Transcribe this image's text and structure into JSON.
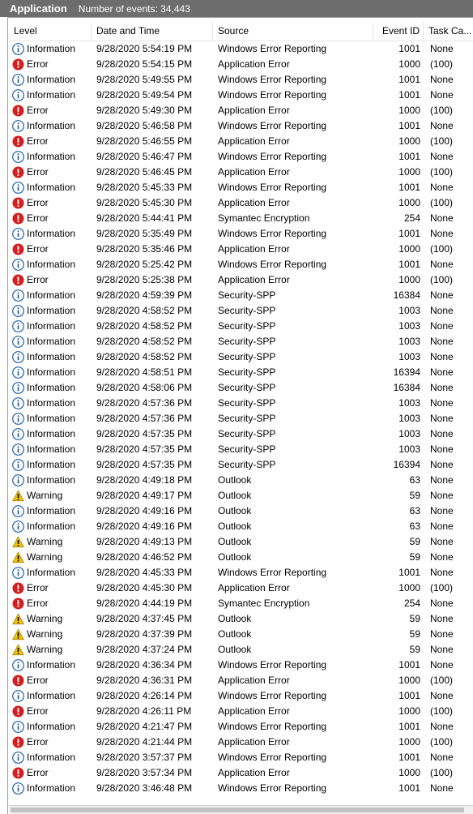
{
  "panel": {
    "title": "Application",
    "event_count": "Number of events: 34,443"
  },
  "columns": {
    "level": "Level",
    "date": "Date and Time",
    "source": "Source",
    "event_id": "Event ID",
    "task": "Task Ca..."
  },
  "colors": {
    "titlebar": "#6d6d6d",
    "info": "#1f5fa8",
    "error": "#d21f1f",
    "warning": "#f2c200"
  },
  "rows": [
    {
      "level": "Information",
      "icon": "info-icon",
      "date": "9/28/2020 5:54:19 PM",
      "source": "Windows Error Reporting",
      "id": "1001",
      "task": "None"
    },
    {
      "level": "Error",
      "icon": "error-icon",
      "date": "9/28/2020 5:54:15 PM",
      "source": "Application Error",
      "id": "1000",
      "task": "(100)"
    },
    {
      "level": "Information",
      "icon": "info-icon",
      "date": "9/28/2020 5:49:55 PM",
      "source": "Windows Error Reporting",
      "id": "1001",
      "task": "None"
    },
    {
      "level": "Information",
      "icon": "info-icon",
      "date": "9/28/2020 5:49:54 PM",
      "source": "Windows Error Reporting",
      "id": "1001",
      "task": "None"
    },
    {
      "level": "Error",
      "icon": "error-icon",
      "date": "9/28/2020 5:49:30 PM",
      "source": "Application Error",
      "id": "1000",
      "task": "(100)"
    },
    {
      "level": "Information",
      "icon": "info-icon",
      "date": "9/28/2020 5:46:58 PM",
      "source": "Windows Error Reporting",
      "id": "1001",
      "task": "None"
    },
    {
      "level": "Error",
      "icon": "error-icon",
      "date": "9/28/2020 5:46:55 PM",
      "source": "Application Error",
      "id": "1000",
      "task": "(100)"
    },
    {
      "level": "Information",
      "icon": "info-icon",
      "date": "9/28/2020 5:46:47 PM",
      "source": "Windows Error Reporting",
      "id": "1001",
      "task": "None"
    },
    {
      "level": "Error",
      "icon": "error-icon",
      "date": "9/28/2020 5:46:45 PM",
      "source": "Application Error",
      "id": "1000",
      "task": "(100)"
    },
    {
      "level": "Information",
      "icon": "info-icon",
      "date": "9/28/2020 5:45:33 PM",
      "source": "Windows Error Reporting",
      "id": "1001",
      "task": "None"
    },
    {
      "level": "Error",
      "icon": "error-icon",
      "date": "9/28/2020 5:45:30 PM",
      "source": "Application Error",
      "id": "1000",
      "task": "(100)"
    },
    {
      "level": "Error",
      "icon": "error-icon",
      "date": "9/28/2020 5:44:41 PM",
      "source": "Symantec Encryption",
      "id": "254",
      "task": "None"
    },
    {
      "level": "Information",
      "icon": "info-icon",
      "date": "9/28/2020 5:35:49 PM",
      "source": "Windows Error Reporting",
      "id": "1001",
      "task": "None"
    },
    {
      "level": "Error",
      "icon": "error-icon",
      "date": "9/28/2020 5:35:46 PM",
      "source": "Application Error",
      "id": "1000",
      "task": "(100)"
    },
    {
      "level": "Information",
      "icon": "info-icon",
      "date": "9/28/2020 5:25:42 PM",
      "source": "Windows Error Reporting",
      "id": "1001",
      "task": "None"
    },
    {
      "level": "Error",
      "icon": "error-icon",
      "date": "9/28/2020 5:25:38 PM",
      "source": "Application Error",
      "id": "1000",
      "task": "(100)"
    },
    {
      "level": "Information",
      "icon": "info-icon",
      "date": "9/28/2020 4:59:39 PM",
      "source": "Security-SPP",
      "id": "16384",
      "task": "None"
    },
    {
      "level": "Information",
      "icon": "info-icon",
      "date": "9/28/2020 4:58:52 PM",
      "source": "Security-SPP",
      "id": "1003",
      "task": "None"
    },
    {
      "level": "Information",
      "icon": "info-icon",
      "date": "9/28/2020 4:58:52 PM",
      "source": "Security-SPP",
      "id": "1003",
      "task": "None"
    },
    {
      "level": "Information",
      "icon": "info-icon",
      "date": "9/28/2020 4:58:52 PM",
      "source": "Security-SPP",
      "id": "1003",
      "task": "None"
    },
    {
      "level": "Information",
      "icon": "info-icon",
      "date": "9/28/2020 4:58:52 PM",
      "source": "Security-SPP",
      "id": "1003",
      "task": "None"
    },
    {
      "level": "Information",
      "icon": "info-icon",
      "date": "9/28/2020 4:58:51 PM",
      "source": "Security-SPP",
      "id": "16394",
      "task": "None"
    },
    {
      "level": "Information",
      "icon": "info-icon",
      "date": "9/28/2020 4:58:06 PM",
      "source": "Security-SPP",
      "id": "16384",
      "task": "None"
    },
    {
      "level": "Information",
      "icon": "info-icon",
      "date": "9/28/2020 4:57:36 PM",
      "source": "Security-SPP",
      "id": "1003",
      "task": "None"
    },
    {
      "level": "Information",
      "icon": "info-icon",
      "date": "9/28/2020 4:57:36 PM",
      "source": "Security-SPP",
      "id": "1003",
      "task": "None"
    },
    {
      "level": "Information",
      "icon": "info-icon",
      "date": "9/28/2020 4:57:35 PM",
      "source": "Security-SPP",
      "id": "1003",
      "task": "None"
    },
    {
      "level": "Information",
      "icon": "info-icon",
      "date": "9/28/2020 4:57:35 PM",
      "source": "Security-SPP",
      "id": "1003",
      "task": "None"
    },
    {
      "level": "Information",
      "icon": "info-icon",
      "date": "9/28/2020 4:57:35 PM",
      "source": "Security-SPP",
      "id": "16394",
      "task": "None"
    },
    {
      "level": "Information",
      "icon": "info-icon",
      "date": "9/28/2020 4:49:18 PM",
      "source": "Outlook",
      "id": "63",
      "task": "None"
    },
    {
      "level": "Warning",
      "icon": "warning-icon",
      "date": "9/28/2020 4:49:17 PM",
      "source": "Outlook",
      "id": "59",
      "task": "None"
    },
    {
      "level": "Information",
      "icon": "info-icon",
      "date": "9/28/2020 4:49:16 PM",
      "source": "Outlook",
      "id": "63",
      "task": "None"
    },
    {
      "level": "Information",
      "icon": "info-icon",
      "date": "9/28/2020 4:49:16 PM",
      "source": "Outlook",
      "id": "63",
      "task": "None"
    },
    {
      "level": "Warning",
      "icon": "warning-icon",
      "date": "9/28/2020 4:49:13 PM",
      "source": "Outlook",
      "id": "59",
      "task": "None"
    },
    {
      "level": "Warning",
      "icon": "warning-icon",
      "date": "9/28/2020 4:46:52 PM",
      "source": "Outlook",
      "id": "59",
      "task": "None"
    },
    {
      "level": "Information",
      "icon": "info-icon",
      "date": "9/28/2020 4:45:33 PM",
      "source": "Windows Error Reporting",
      "id": "1001",
      "task": "None"
    },
    {
      "level": "Error",
      "icon": "error-icon",
      "date": "9/28/2020 4:45:30 PM",
      "source": "Application Error",
      "id": "1000",
      "task": "(100)"
    },
    {
      "level": "Error",
      "icon": "error-icon",
      "date": "9/28/2020 4:44:19 PM",
      "source": "Symantec Encryption",
      "id": "254",
      "task": "None"
    },
    {
      "level": "Warning",
      "icon": "warning-icon",
      "date": "9/28/2020 4:37:45 PM",
      "source": "Outlook",
      "id": "59",
      "task": "None"
    },
    {
      "level": "Warning",
      "icon": "warning-icon",
      "date": "9/28/2020 4:37:39 PM",
      "source": "Outlook",
      "id": "59",
      "task": "None"
    },
    {
      "level": "Warning",
      "icon": "warning-icon",
      "date": "9/28/2020 4:37:24 PM",
      "source": "Outlook",
      "id": "59",
      "task": "None"
    },
    {
      "level": "Information",
      "icon": "info-icon",
      "date": "9/28/2020 4:36:34 PM",
      "source": "Windows Error Reporting",
      "id": "1001",
      "task": "None"
    },
    {
      "level": "Error",
      "icon": "error-icon",
      "date": "9/28/2020 4:36:31 PM",
      "source": "Application Error",
      "id": "1000",
      "task": "(100)"
    },
    {
      "level": "Information",
      "icon": "info-icon",
      "date": "9/28/2020 4:26:14 PM",
      "source": "Windows Error Reporting",
      "id": "1001",
      "task": "None"
    },
    {
      "level": "Error",
      "icon": "error-icon",
      "date": "9/28/2020 4:26:11 PM",
      "source": "Application Error",
      "id": "1000",
      "task": "(100)"
    },
    {
      "level": "Information",
      "icon": "info-icon",
      "date": "9/28/2020 4:21:47 PM",
      "source": "Windows Error Reporting",
      "id": "1001",
      "task": "None"
    },
    {
      "level": "Error",
      "icon": "error-icon",
      "date": "9/28/2020 4:21:44 PM",
      "source": "Application Error",
      "id": "1000",
      "task": "(100)"
    },
    {
      "level": "Information",
      "icon": "info-icon",
      "date": "9/28/2020 3:57:37 PM",
      "source": "Windows Error Reporting",
      "id": "1001",
      "task": "None"
    },
    {
      "level": "Error",
      "icon": "error-icon",
      "date": "9/28/2020 3:57:34 PM",
      "source": "Application Error",
      "id": "1000",
      "task": "(100)"
    },
    {
      "level": "Information",
      "icon": "info-icon",
      "date": "9/28/2020 3:46:48 PM",
      "source": "Windows Error Reporting",
      "id": "1001",
      "task": "None"
    }
  ]
}
